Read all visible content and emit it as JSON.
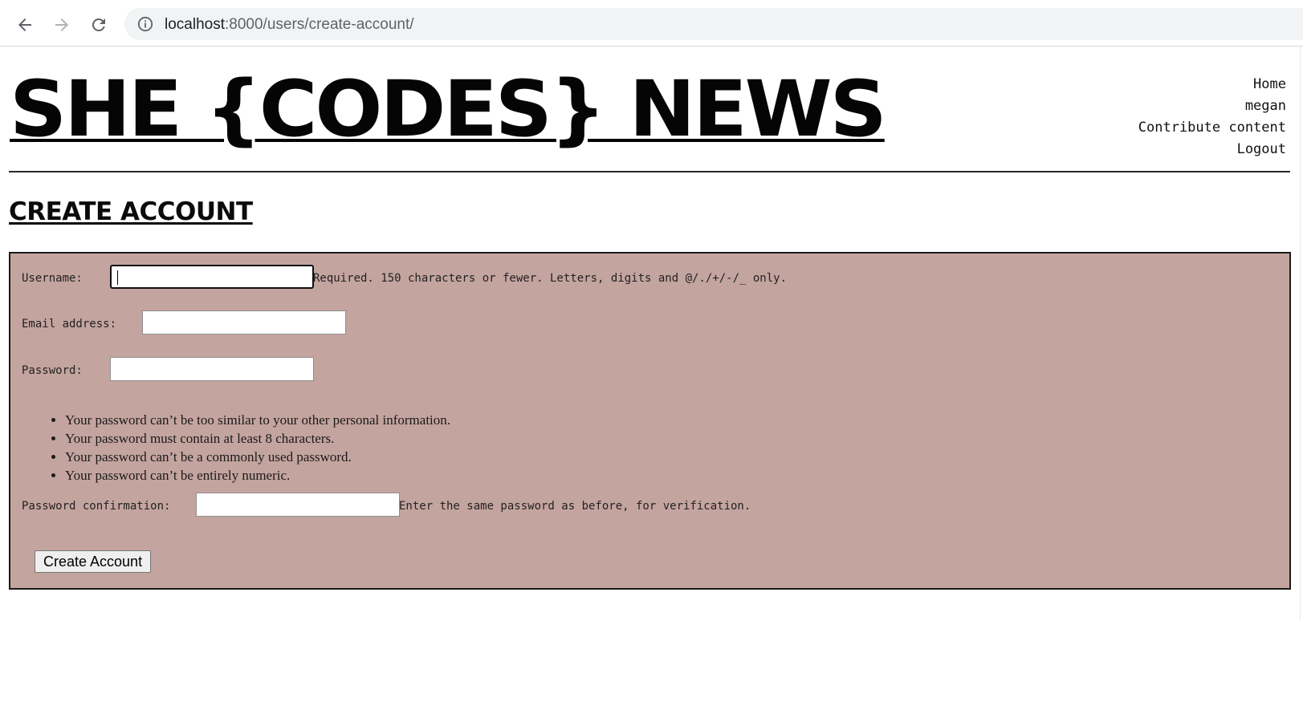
{
  "browser": {
    "url_host": "localhost",
    "url_path": ":8000/users/create-account/",
    "icons": {
      "back": "arrow-left-icon",
      "forward": "arrow-right-icon",
      "reload": "reload-icon",
      "site_info": "info-icon"
    }
  },
  "header": {
    "site_title": "SHE {CODES} NEWS",
    "nav": [
      "Home",
      "megan",
      "Contribute content",
      "Logout"
    ]
  },
  "main": {
    "heading": "CREATE ACCOUNT"
  },
  "form": {
    "background_color": "#c4a49f",
    "username": {
      "label": "Username:",
      "value": "",
      "help": "Required. 150 characters or fewer. Letters, digits and @/./+/-/_ only."
    },
    "email": {
      "label": "Email address:",
      "value": ""
    },
    "password": {
      "label": "Password:",
      "value": ""
    },
    "password_rules": [
      "Your password can’t be too similar to your other personal information.",
      "Your password must contain at least 8 characters.",
      "Your password can’t be a commonly used password.",
      "Your password can’t be entirely numeric."
    ],
    "password_confirmation": {
      "label": "Password confirmation:",
      "value": "",
      "help": "Enter the same password as before, for verification."
    },
    "submit_label": "Create Account"
  }
}
